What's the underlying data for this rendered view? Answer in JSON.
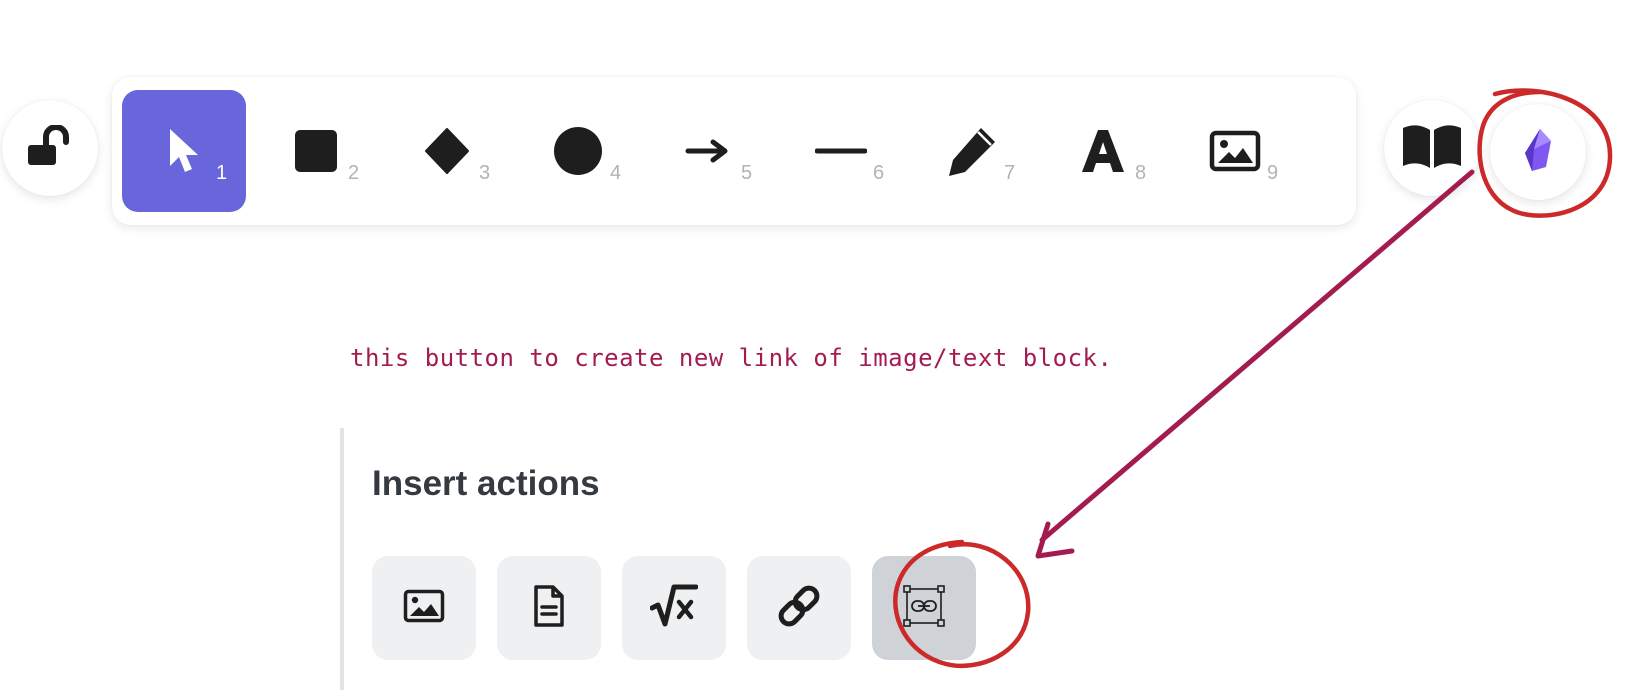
{
  "toolbar": {
    "lock": {
      "icon": "unlocked-padlock-icon"
    },
    "tools": [
      {
        "id": "selection",
        "icon": "pointer-arrow-icon",
        "shortcut": "1",
        "active": true
      },
      {
        "id": "rectangle",
        "icon": "square-icon",
        "shortcut": "2"
      },
      {
        "id": "diamond",
        "icon": "diamond-icon",
        "shortcut": "3"
      },
      {
        "id": "ellipse",
        "icon": "circle-icon",
        "shortcut": "4"
      },
      {
        "id": "arrow",
        "icon": "arrow-right-icon",
        "shortcut": "5"
      },
      {
        "id": "line",
        "icon": "line-icon",
        "shortcut": "6"
      },
      {
        "id": "draw",
        "icon": "pencil-icon",
        "shortcut": "7"
      },
      {
        "id": "text",
        "icon": "letter-a-icon",
        "shortcut": "8"
      },
      {
        "id": "image",
        "icon": "image-icon",
        "shortcut": "9"
      }
    ],
    "library": {
      "icon": "open-book-icon"
    },
    "obsidian": {
      "icon": "obsidian-crystal-icon",
      "accent": "#7e58f0"
    }
  },
  "annotation": {
    "text": "this button to create new link of image/text block.",
    "color": "#a41c4f"
  },
  "insert_panel": {
    "title": "Insert actions",
    "actions": [
      {
        "id": "insert-image",
        "icon": "image-icon"
      },
      {
        "id": "insert-file",
        "icon": "document-icon"
      },
      {
        "id": "insert-latex",
        "icon": "square-root-x-icon"
      },
      {
        "id": "insert-link",
        "icon": "link-icon"
      },
      {
        "id": "insert-link-to-element",
        "icon": "link-to-element-icon",
        "hover": true
      }
    ]
  },
  "colors": {
    "accent": "#6965db",
    "annotation": "#a41c4f",
    "icon": "#1e1e1e",
    "shortcut": "#b3b3b3"
  }
}
